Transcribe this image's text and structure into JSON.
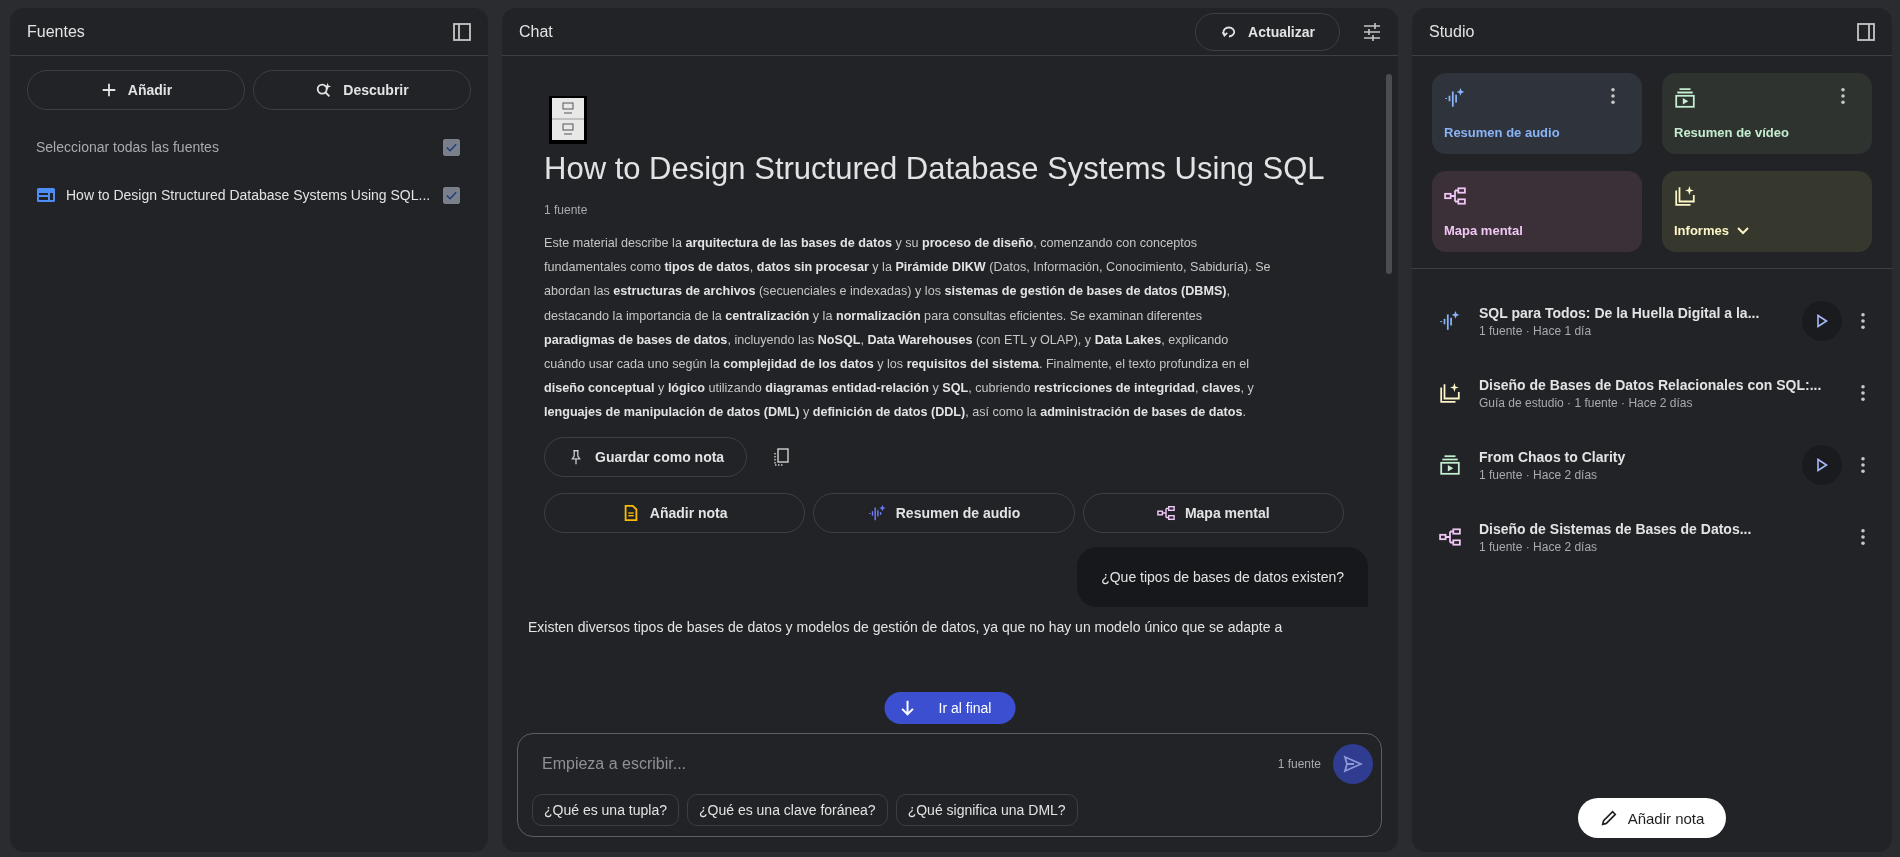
{
  "sources_panel": {
    "title": "Fuentes",
    "add_button": "Añadir",
    "discover_button": "Descubrir",
    "select_all": {
      "label": "Seleccionar todas las fuentes",
      "checked": true
    },
    "sources": [
      {
        "title": "How to Design Structured Database Systems Using SQL...",
        "checked": true
      }
    ]
  },
  "chat": {
    "title": "Chat",
    "refresh_button": "Actualizar",
    "notebook_title": "How to Design Structured Database Systems Using SQL",
    "source_count": "1 fuente",
    "summary": "Este material describe la **arquitectura de las bases de datos** y su **proceso de diseño**, comenzando con conceptos fundamentales como **tipos de datos**, **datos sin procesar** y la **Pirámide DIKW** (Datos, Información, Conocimiento, Sabiduría). Se abordan las **estructuras de archivos** (secuenciales e indexadas) y los **sistemas de gestión de bases de datos (DBMS)**, destacando la importancia de la **centralización** y la **normalización** para consultas eficientes. Se examinan diferentes **paradigmas de bases de datos**, incluyendo las **NoSQL**, **Data Warehouses** (con ETL y OLAP), y **Data Lakes**, explicando cuándo usar cada uno según la **complejidad de los datos** y los **requisitos del sistema**. Finalmente, el texto profundiza en el **diseño conceptual** y **lógico** utilizando **diagramas entidad-relación** y **SQL**, cubriendo **restricciones de integridad**, **claves**, y **lenguajes de manipulación de datos (DML)** y **definición de datos (DDL)**, así como la **administración de bases de datos**.",
    "save_note_button": "Guardar como nota",
    "actions": [
      {
        "kind": "note",
        "label": "Añadir nota"
      },
      {
        "kind": "audio",
        "label": "Resumen de audio"
      },
      {
        "kind": "mindmap",
        "label": "Mapa mental"
      }
    ],
    "user_message": "¿Que tipos de bases de datos existen?",
    "scroll_button": "Ir al final",
    "answer_start": "Existen diversos tipos de bases de datos y modelos de gestión de datos, ya que no hay un modelo único que se adapte a",
    "input": {
      "placeholder": "Empieza a escribir...",
      "source_count": "1 fuente"
    },
    "suggestions": [
      "¿Qué es una tupla?",
      "¿Qué es una clave foránea?",
      "¿Qué significa una DML?"
    ]
  },
  "studio": {
    "title": "Studio",
    "tiles": [
      {
        "kind": "audio",
        "label": "Resumen de audio",
        "color": "#2f333b",
        "menu": true
      },
      {
        "kind": "video",
        "label": "Resumen de vídeo",
        "color": "#2e332f",
        "menu": true
      },
      {
        "kind": "mindmap",
        "label": "Mapa mental",
        "color": "#3b3037",
        "menu": false
      },
      {
        "kind": "report",
        "label": "Informes",
        "color": "#37382d",
        "menu": false
      }
    ],
    "outputs": [
      {
        "kind": "audio",
        "title": "SQL para Todos: De la Huella Digital a la...",
        "meta": "1 fuente · Hace 1 día",
        "playable": true
      },
      {
        "kind": "report",
        "title": "Diseño de Bases de Datos Relacionales con SQL:...",
        "meta": "Guía de estudio · 1 fuente · Hace 2 días",
        "playable": false
      },
      {
        "kind": "video",
        "title": "From Chaos to Clarity",
        "meta": "1 fuente · Hace 2 días",
        "playable": true
      },
      {
        "kind": "mindmap",
        "title": "Diseño de Sistemas de Bases de Datos...",
        "meta": "1 fuente · Hace 2 días",
        "playable": false
      }
    ],
    "add_note_button": "Añadir nota"
  }
}
